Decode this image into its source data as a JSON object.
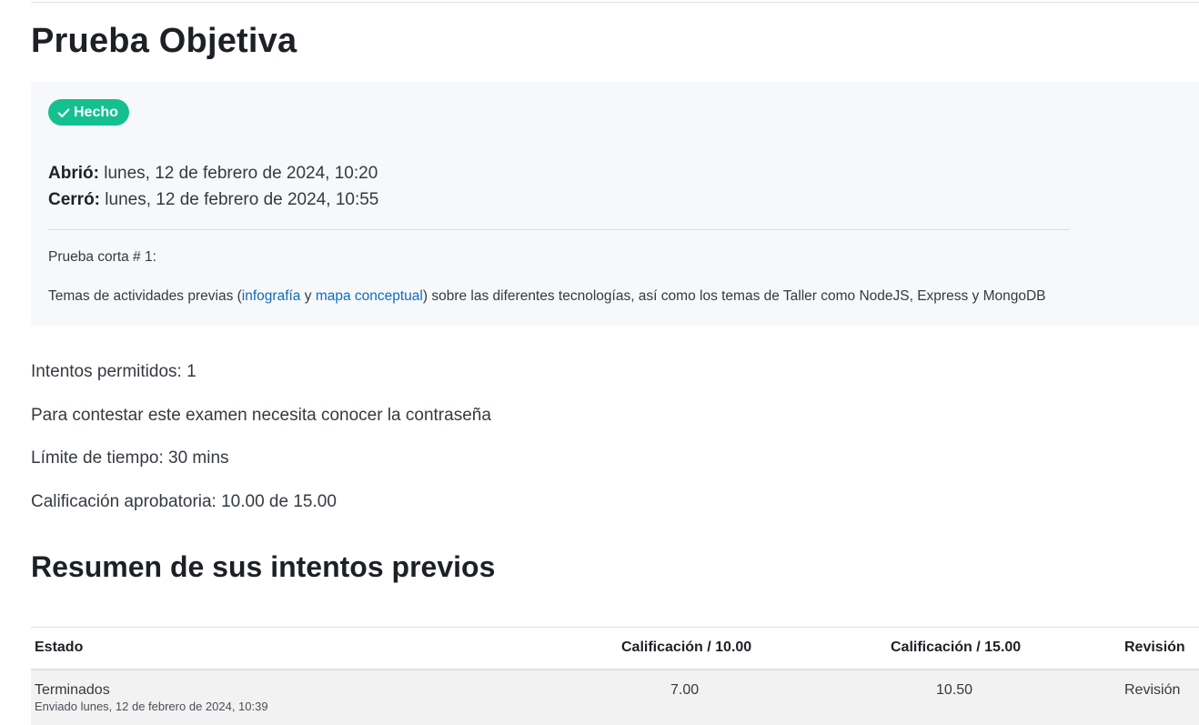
{
  "page": {
    "title": "Prueba Objetiva"
  },
  "status": {
    "badge_label": "Hecho",
    "icon": "check-icon",
    "color": "#14c08f"
  },
  "dates": {
    "opened_label": "Abrió:",
    "opened_value": "lunes, 12 de febrero de 2024, 10:20",
    "closed_label": "Cerró:",
    "closed_value": "lunes, 12 de febrero de 2024, 10:55"
  },
  "description": {
    "line1": "Prueba corta # 1:",
    "line2_before": "Temas de actividades previas (",
    "link1": "infografía",
    "line2_mid": " y ",
    "link2": "mapa conceptual",
    "line2_after": ") sobre las diferentes tecnologías, así como los temas de Taller como NodeJS, Express y MongoDB"
  },
  "quiz_info": {
    "attempts": "Intentos permitidos: 1",
    "password": "Para contestar este examen necesita conocer la contraseña",
    "time_limit": "Límite de tiempo: 30 mins",
    "passing_grade": "Calificación aprobatoria: 10.00 de 15.00"
  },
  "summary": {
    "title": "Resumen de sus intentos previos",
    "headers": {
      "estado": "Estado",
      "cal10": "Calificación / 10.00",
      "cal15": "Calificación / 15.00",
      "revision": "Revisión"
    },
    "rows": [
      {
        "estado": "Terminados",
        "sent": "Enviado lunes, 12 de febrero de 2024, 10:39",
        "cal10": "7.00",
        "cal15": "10.50",
        "revision": "Revisión"
      }
    ]
  },
  "colors": {
    "link": "#0f6cbf",
    "box_bg": "#f7f8fa"
  }
}
